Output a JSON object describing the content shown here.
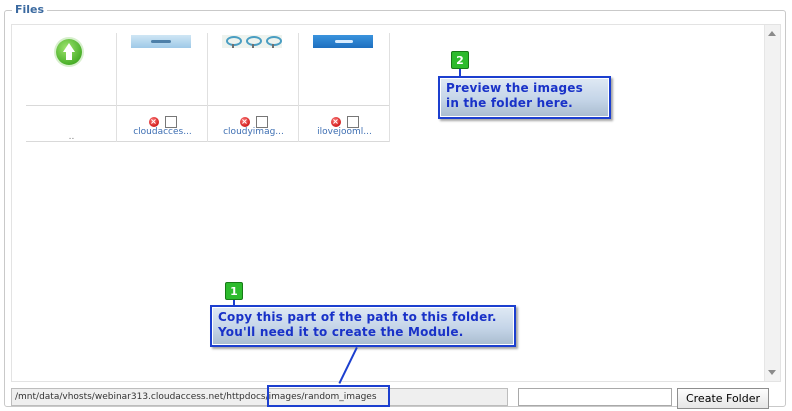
{
  "fieldset": {
    "legend": "Files"
  },
  "files": {
    "up_label": "..",
    "items": [
      {
        "name": "cloudacces..."
      },
      {
        "name": "cloudyimag..."
      },
      {
        "name": "ilovejooml..."
      }
    ]
  },
  "callouts": [
    {
      "number": "2",
      "lines": [
        "Preview the images",
        "in the folder here."
      ]
    },
    {
      "number": "1",
      "lines": [
        "Copy this part of the path to this folder.",
        "You'll need it to create the Module."
      ]
    }
  ],
  "path": {
    "value": "/mnt/data/vhosts/webinar313.cloudaccess.net/httpdocs/images/random_images"
  },
  "create_folder": {
    "input_value": "",
    "button_label": "Create Folder"
  },
  "colors": {
    "callout_border": "#1c3fcf",
    "callout_text": "#1932c8",
    "badge": "#2dbb2d",
    "legend": "#3b6aa0",
    "filename": "#3e6fb3"
  },
  "icons": {
    "up": "folder-up-icon",
    "delete": "delete-icon"
  }
}
